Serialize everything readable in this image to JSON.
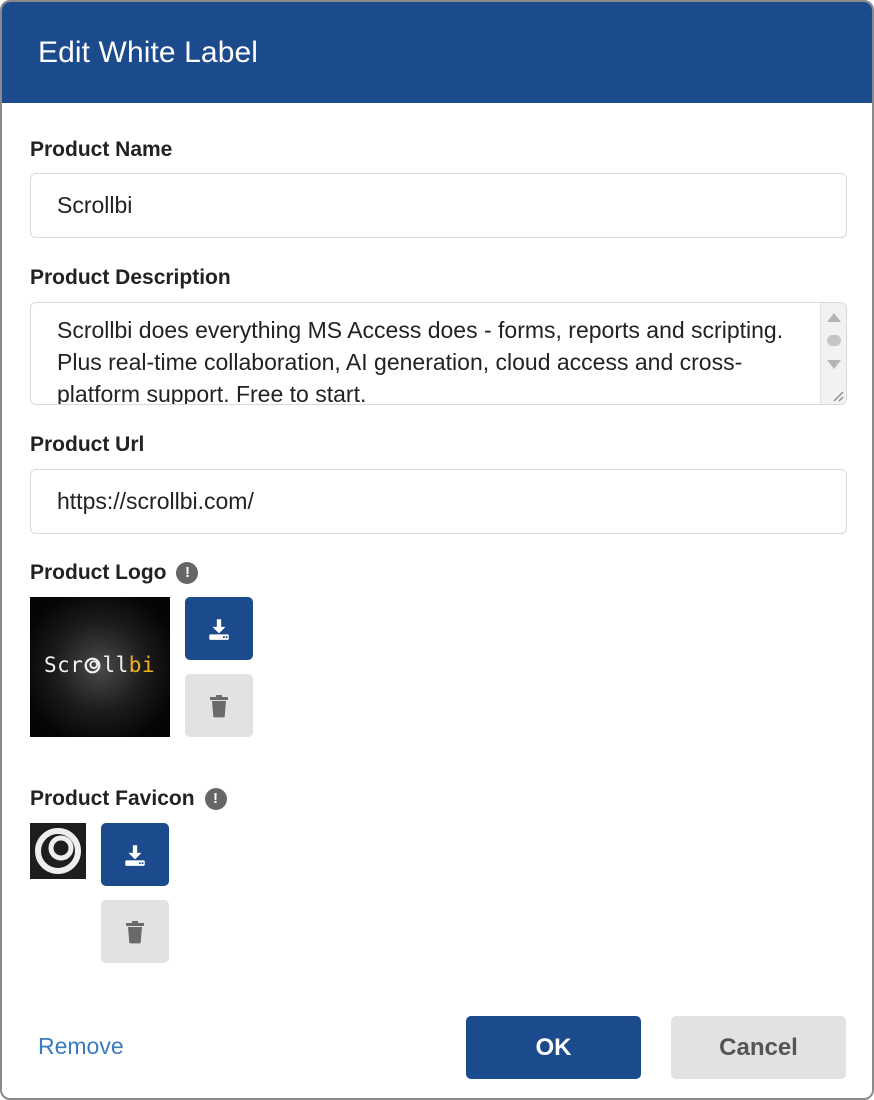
{
  "dialog": {
    "title": "Edit White Label"
  },
  "fields": {
    "product_name_label": "Product Name",
    "product_name_value": "Scrollbi",
    "product_description_label": "Product Description",
    "product_description_value": "Scrollbi does everything MS Access does - forms, reports and scripting. Plus real-time collaboration, AI generation, cloud access and cross-platform support. Free to start.",
    "product_url_label": "Product Url",
    "product_url_value": "https://scrollbi.com/",
    "product_logo_label": "Product Logo",
    "product_favicon_label": "Product Favicon"
  },
  "logo": {
    "text_prefix": "Scr",
    "text_mid": "ll",
    "text_highlight": "bi"
  },
  "icons": {
    "info": "!",
    "download": "download-icon",
    "delete": "trash-icon"
  },
  "footer": {
    "remove_label": "Remove",
    "ok_label": "OK",
    "cancel_label": "Cancel"
  },
  "colors": {
    "header_bg": "#1b4a8d",
    "primary": "#1b4a8d",
    "secondary": "#e2e2e2",
    "link": "#3a7bbf",
    "logo_highlight": "#f2b01e"
  }
}
